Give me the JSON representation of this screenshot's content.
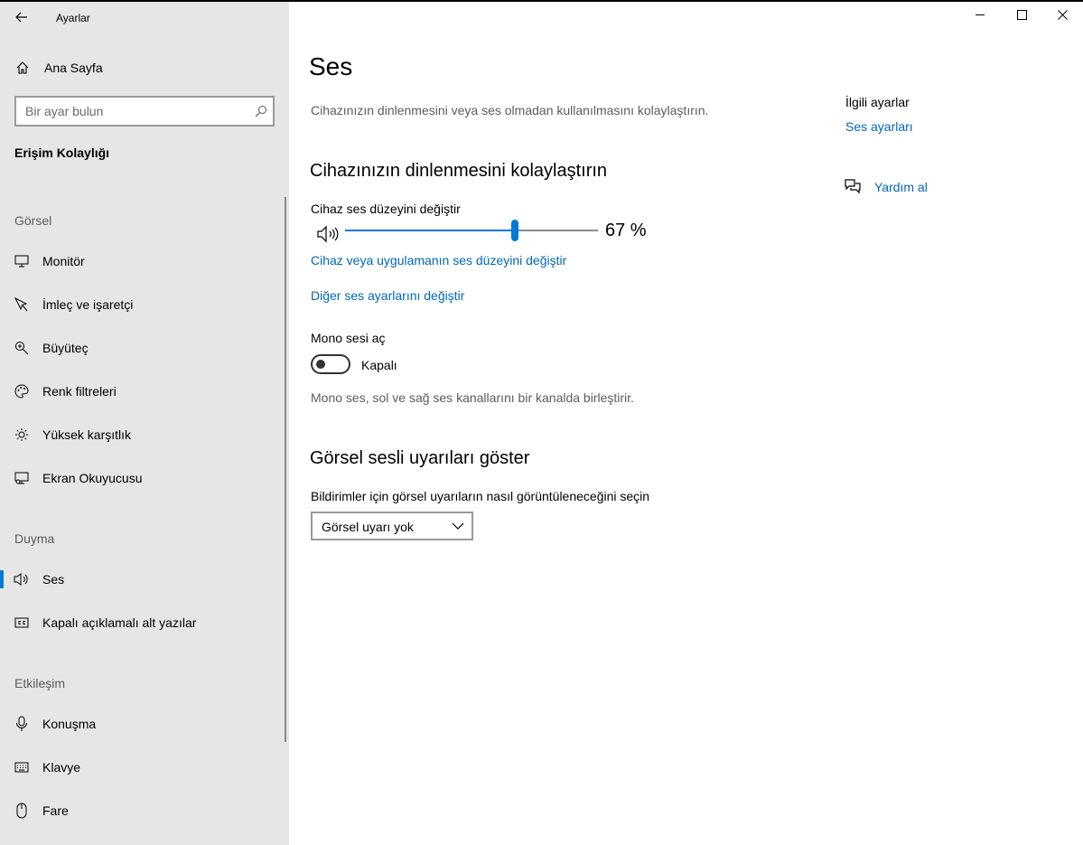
{
  "window": {
    "title": "Ayarlar",
    "controls": {
      "minimize": "minimize-icon",
      "maximize": "maximize-icon",
      "close": "close-icon"
    }
  },
  "sidebar": {
    "home_label": "Ana Sayfa",
    "search_placeholder": "Bir ayar bulun",
    "category_title": "Erişim Kolaylığı",
    "groups": [
      {
        "heading": "Görsel",
        "items": [
          {
            "label": "Monitör",
            "icon": "monitor-icon"
          },
          {
            "label": "İmleç ve işaretçi",
            "icon": "cursor-icon"
          },
          {
            "label": "Büyüteç",
            "icon": "magnifier-icon"
          },
          {
            "label": "Renk filtreleri",
            "icon": "color-palette-icon"
          },
          {
            "label": "Yüksek karşıtlık",
            "icon": "brightness-icon"
          },
          {
            "label": "Ekran Okuyucusu",
            "icon": "narrator-icon"
          }
        ]
      },
      {
        "heading": "Duyma",
        "items": [
          {
            "label": "Ses",
            "icon": "speaker-icon",
            "active": true
          },
          {
            "label": "Kapalı açıklamalı alt yazılar",
            "icon": "closed-captions-icon"
          }
        ]
      },
      {
        "heading": "Etkileşim",
        "items": [
          {
            "label": "Konuşma",
            "icon": "microphone-icon"
          },
          {
            "label": "Klavye",
            "icon": "keyboard-icon"
          },
          {
            "label": "Fare",
            "icon": "mouse-icon"
          }
        ]
      }
    ],
    "accent_color": "#0078d7"
  },
  "main": {
    "page_title": "Ses",
    "description": "Cihazınızın dinlenmesini veya ses olmadan kullanılmasını kolaylaştırın.",
    "section1": {
      "heading": "Cihazınızın dinlenmesini kolaylaştırın",
      "volume_label": "Cihaz ses düzeyini değiştir",
      "volume_value": 67,
      "volume_display": "67 %",
      "link_app_volume": "Cihaz veya uygulamanın ses düzeyini değiştir",
      "link_other_sound": "Diğer ses ayarlarını değiştir",
      "mono_label": "Mono sesi aç",
      "mono_state": "Kapalı",
      "mono_on": false,
      "mono_desc": "Mono ses, sol ve sağ ses kanallarını bir kanalda birleştirir."
    },
    "section2": {
      "heading": "Görsel sesli uyarıları göster",
      "select_label": "Bildirimler için görsel uyarıların nasıl görüntüleneceğini seçin",
      "select_value": "Görsel uyarı yok"
    },
    "related": {
      "heading": "İlgili ayarlar",
      "link": "Ses ayarları",
      "help_label": "Yardım al"
    },
    "link_color": "#0067b8"
  }
}
